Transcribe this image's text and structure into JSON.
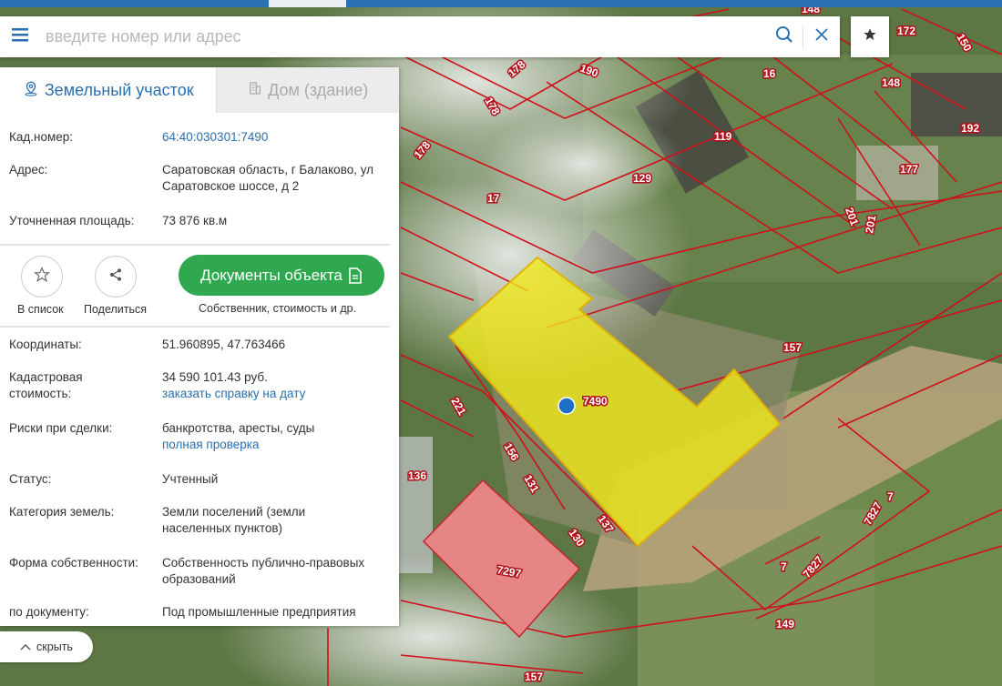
{
  "search": {
    "placeholder": "введите номер или адрес",
    "value": ""
  },
  "tabs": [
    {
      "label": "Земельный участок",
      "active": true
    },
    {
      "label": "Дом (здание)",
      "active": false
    }
  ],
  "details_top": [
    {
      "label": "Кад.номер:",
      "value": "64:40:030301:7490"
    },
    {
      "label": "Адрес:",
      "value": "Саратовская область, г Балаково, ул Саратовское шоссе, д 2"
    },
    {
      "label": "Уточненная площадь:",
      "value": "73 876 кв.м"
    }
  ],
  "actions": {
    "favorite_label": "В список",
    "share_label": "Поделиться",
    "documents_label": "Документы объекта",
    "documents_sub": "Собственник, стоимость и др."
  },
  "details_bottom": {
    "coordinates": {
      "label": "Координаты:",
      "value": "51.960895, 47.763466"
    },
    "cadastral_value": {
      "label": "Кадастровая стоимость:",
      "value": "34 590 101.43 руб.",
      "link": "заказать справку на дату"
    },
    "risks": {
      "label": "Риски при сделки:",
      "value": "банкротства, аресты, суды",
      "link": "полная проверка"
    },
    "status": {
      "label": "Статус:",
      "value": "Учтенный"
    },
    "category": {
      "label": "Категория земель:",
      "value": "Земли поселений (земли населенных пунктов)"
    },
    "ownership": {
      "label": "Форма собственности:",
      "value": "Собственность публично-правовых образований"
    },
    "document": {
      "label": "по документу:",
      "value": "Под промышленные предприятия"
    }
  },
  "hide_label": "скрыть",
  "map": {
    "selected_parcel": "7490",
    "neighbor_parcel": "7297",
    "parcel_numbers": [
      "148",
      "172",
      "150",
      "178",
      "190",
      "16",
      "148",
      "178",
      "192",
      "119",
      "129",
      "178",
      "177",
      "201",
      "201",
      "17",
      "157",
      "221",
      "156",
      "131",
      "136",
      "137",
      "130",
      "7827",
      "7",
      "7",
      "7827",
      "149",
      "157"
    ]
  },
  "colors": {
    "accent": "#2a6fb0",
    "documents_button": "#2fa84f",
    "selected_parcel": "#f2ea18",
    "neighbor_parcel": "#e58585",
    "parcel_border": "#d0101a"
  }
}
